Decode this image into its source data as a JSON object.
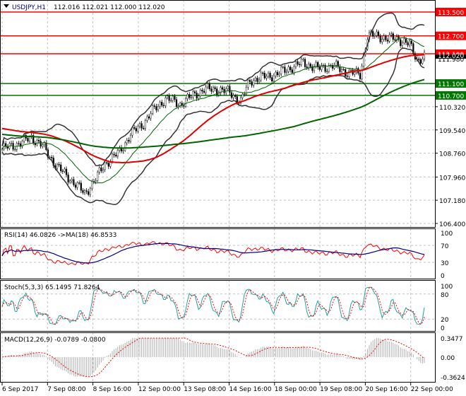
{
  "header": {
    "symbol": "USDJPY,H1",
    "ohlc": "112.016 112.021 112.000 112.020"
  },
  "price_axis": {
    "ticks": [
      "110.320",
      "109.540",
      "108.760",
      "107.960",
      "107.180",
      "106.400"
    ],
    "tick_values": [
      110.32,
      109.54,
      108.76,
      107.96,
      107.18,
      106.4
    ],
    "current_price": "112.020",
    "bid_label": "111.980"
  },
  "levels": [
    {
      "label": "113.500",
      "value": 113.5,
      "color": "#ff0000"
    },
    {
      "label": "112.700",
      "value": 112.7,
      "color": "#ff0000"
    },
    {
      "label": "112.100",
      "value": 112.1,
      "color": "#ff0000"
    },
    {
      "label": "111.100",
      "value": 111.1,
      "color": "#007700"
    },
    {
      "label": "110.700",
      "value": 110.7,
      "color": "#007700"
    }
  ],
  "rsi": {
    "title": "RSI(14) 46.0826  ->MA(18) 46.8533",
    "ticks": [
      "100",
      "70",
      "30",
      "0"
    ],
    "tick_values": [
      100,
      70,
      30,
      0
    ]
  },
  "stoch": {
    "title": "Stoch(5,3,3) 65.1495 71.8264",
    "ticks": [
      "100",
      "80",
      "20",
      "0"
    ],
    "tick_values": [
      100,
      80,
      20,
      0
    ]
  },
  "macd": {
    "title": "MACD(12,26,9) -0.0789 -0.0800",
    "ticks": [
      "0.3477",
      "0.00",
      "-0.3624"
    ],
    "tick_values": [
      0.3477,
      0,
      -0.3624
    ]
  },
  "time_axis": [
    "6 Sep 2017",
    "7 Sep 08:00",
    "8 Sep 16:00",
    "12 Sep 00:00",
    "13 Sep 08:00",
    "14 Sep 16:00",
    "18 Sep 00:00",
    "19 Sep 08:00",
    "20 Sep 16:00",
    "22 Sep 00:00"
  ],
  "colors": {
    "bull": "#000000",
    "ma_fast": "#e00000",
    "ma_slow": "#006400",
    "bands": "#333333",
    "rsi": "#ff0000",
    "rsi_ma": "#000080",
    "stoch": "#20a0a0",
    "macd_hist": "#b0b0b0"
  },
  "chart_data": {
    "type": "line",
    "price_range": [
      106.4,
      113.5
    ],
    "bars": 231,
    "close_keypoints": [
      [
        0,
        108.9
      ],
      [
        10,
        109.1
      ],
      [
        16,
        109.3
      ],
      [
        22,
        109.0
      ],
      [
        30,
        108.3
      ],
      [
        37,
        107.9
      ],
      [
        45,
        107.4
      ],
      [
        51,
        107.9
      ],
      [
        56,
        108.4
      ],
      [
        64,
        108.8
      ],
      [
        70,
        109.4
      ],
      [
        76,
        109.7
      ],
      [
        81,
        110.1
      ],
      [
        89,
        110.6
      ],
      [
        97,
        110.4
      ],
      [
        104,
        110.7
      ],
      [
        110,
        110.9
      ],
      [
        118,
        110.9
      ],
      [
        124,
        110.8
      ],
      [
        130,
        110.5
      ],
      [
        135,
        111.2
      ],
      [
        141,
        111.3
      ],
      [
        149,
        111.4
      ],
      [
        156,
        111.6
      ],
      [
        164,
        111.8
      ],
      [
        172,
        111.6
      ],
      [
        180,
        111.7
      ],
      [
        187,
        111.5
      ],
      [
        195,
        111.4
      ],
      [
        199,
        112.7
      ],
      [
        205,
        112.7
      ],
      [
        210,
        112.6
      ],
      [
        216,
        112.6
      ],
      [
        222,
        112.4
      ],
      [
        226,
        111.9
      ],
      [
        230,
        112.0
      ]
    ]
  }
}
